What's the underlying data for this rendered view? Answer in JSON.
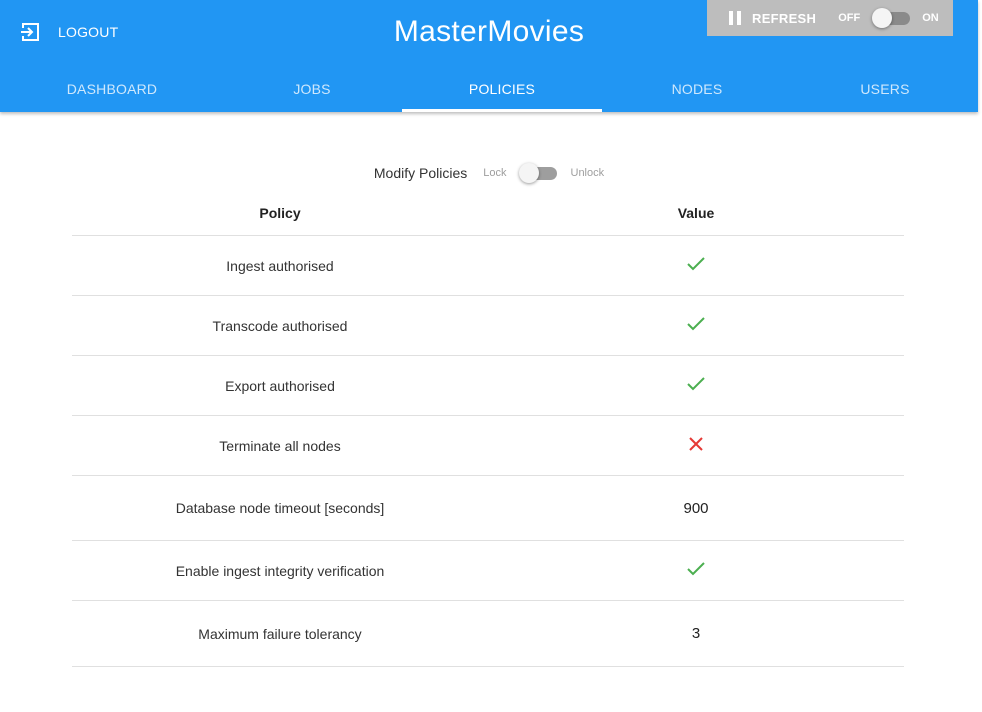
{
  "header": {
    "logout_label": "LOGOUT",
    "app_title": "MasterMovies",
    "refresh": {
      "label": "REFRESH",
      "off_label": "OFF",
      "on_label": "ON",
      "enabled": false
    },
    "tabs": [
      {
        "label": "DASHBOARD",
        "active": false
      },
      {
        "label": "JOBS",
        "active": false
      },
      {
        "label": "POLICIES",
        "active": true
      },
      {
        "label": "NODES",
        "active": false
      },
      {
        "label": "USERS",
        "active": false
      }
    ]
  },
  "modify": {
    "label": "Modify Policies",
    "lock_label": "Lock",
    "unlock_label": "Unlock",
    "unlocked": false
  },
  "table": {
    "columns": [
      "Policy",
      "Value"
    ],
    "rows": [
      {
        "policy": "Ingest authorised",
        "value": true,
        "icon": "check-icon"
      },
      {
        "policy": "Transcode authorised",
        "value": true,
        "icon": "check-icon"
      },
      {
        "policy": "Export authorised",
        "value": true,
        "icon": "check-icon"
      },
      {
        "policy": "Terminate all nodes",
        "value": false,
        "icon": "cross-icon"
      },
      {
        "policy": "Database node timeout [seconds]",
        "value": "900"
      },
      {
        "policy": "Enable ingest integrity verification",
        "value": true,
        "icon": "check-icon"
      },
      {
        "policy": "Maximum failure tolerancy",
        "value": "3"
      }
    ]
  },
  "colors": {
    "primary": "#2196f3",
    "check": "#4caf50",
    "cross": "#e53935",
    "refresh_panel": "#bdbdbd"
  }
}
